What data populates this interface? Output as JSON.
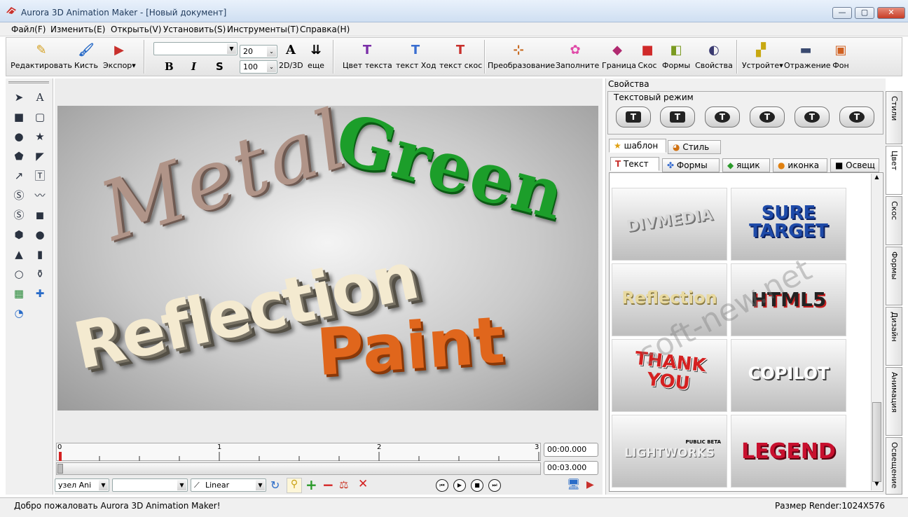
{
  "window": {
    "title": "Aurora 3D Animation Maker - [Новый документ]",
    "minimize": "—",
    "maximize": "▢",
    "close": "✕"
  },
  "menu": [
    "Файл(F)",
    "Изменить(E)",
    "Открыть(V)",
    "Установить(S)",
    "Инструменты(T)",
    "Справка(H)"
  ],
  "toolbar": {
    "edit": "Редактировать",
    "brush": "Кисть",
    "export": "Экспор",
    "font_size": "20",
    "zoom": "100",
    "bold": "B",
    "italic": "I",
    "shadow": "S",
    "mode_2d3d": "2D/3D",
    "more": "еще",
    "text_color": "Цвет текста",
    "text_path": "текст Ход",
    "text_bevel": "текст скос",
    "transform": "Преобразование",
    "fill": "Заполните",
    "border": "Граница",
    "bevel": "Скос",
    "shapes": "Формы",
    "properties": "Свойства",
    "device": "Устройте",
    "reflection": "Отражение",
    "background": "Фон"
  },
  "scene": {
    "texts": [
      "Metal",
      "Green",
      "Reflection",
      "Paint"
    ]
  },
  "timeline": {
    "ticks": [
      "0",
      "1",
      "2",
      "3"
    ],
    "current_time": "00:00.000",
    "end_time": "00:03.000",
    "node_select": "узел Ani",
    "interp_select": "Linear"
  },
  "panel": {
    "title": "Свойства",
    "text_mode": "Текстовый режим",
    "tabs_top": [
      "шаблон",
      "Стиль"
    ],
    "tabs_cat": [
      "Текст",
      "Формы",
      "ящик",
      "иконка",
      "Освещ"
    ],
    "thumbs": [
      "DIVMEDIA",
      "SURE TARGET",
      "Reflection",
      "HTML5",
      "THANK YOU",
      "COPILOT",
      "LIGHTWORKS",
      "LEGEND"
    ],
    "thumb_small": "PUBLIC BETA"
  },
  "side_tabs": [
    "Стили",
    "Цвет",
    "Скос",
    "Формы",
    "Дизайн",
    "Анимация",
    "Освещение"
  ],
  "status": {
    "left": "Добро пожаловать Aurora 3D Animation Maker!",
    "right": "Размер Render:1024X576"
  },
  "watermark": "soft-new.net",
  "colors": {
    "green_text": "#1c9e2a",
    "paint_text": "#e0661c",
    "legend_text": "#c8102e"
  }
}
